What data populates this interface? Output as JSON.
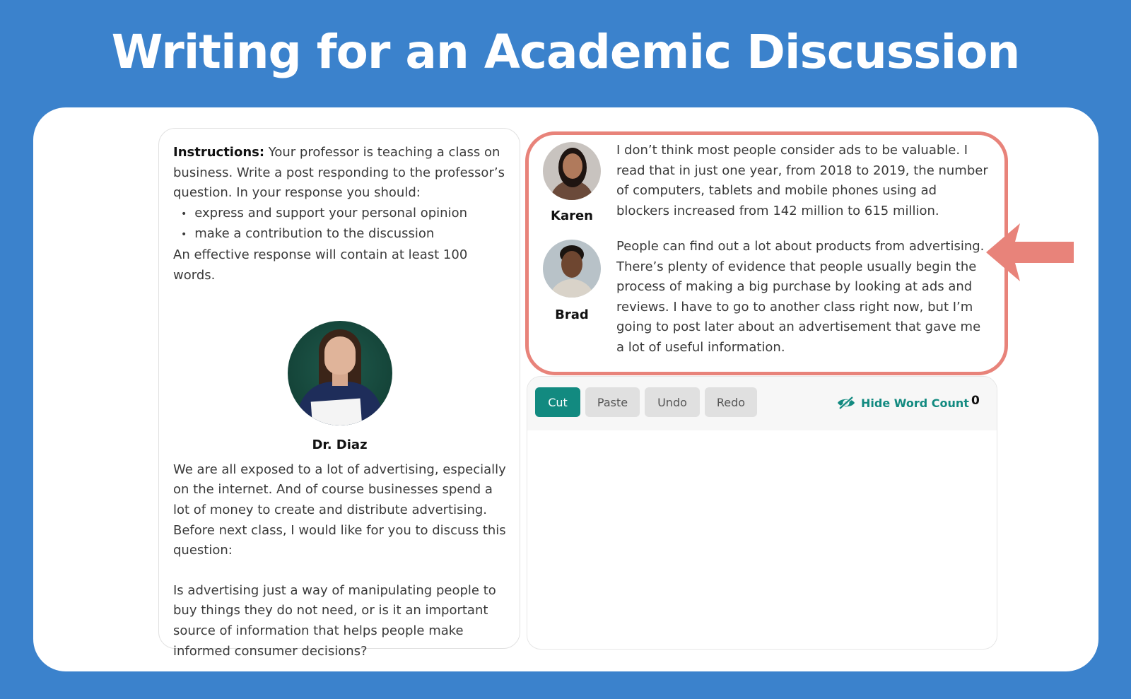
{
  "title": "Writing for an Academic Discussion",
  "instructions": {
    "label": "Instructions:",
    "text": " Your professor is teaching a class on business. Write a post responding to the professor’s question. In your response you should:",
    "bullets": [
      "express and support your personal opinion",
      "make a contribution to the discussion"
    ],
    "footer": "An effective response will contain at least 100 words."
  },
  "professor": {
    "name": "Dr. Diaz",
    "text": "We are all exposed to a lot of advertising, especially on the internet. And of course businesses spend a lot of money to create and distribute advertising. Before next class, I would like for you to discuss this question:",
    "question": "Is advertising just a way of manipulating people to buy things they do not need, or is it an important source of information that helps people make informed consumer decisions?"
  },
  "students": [
    {
      "name": "Karen",
      "text": "I don’t think most people consider ads to be valuable. I read that in just one year, from 2018 to 2019, the number of computers, tablets and mobile phones using ad blockers increased from 142 million to 615 million."
    },
    {
      "name": "Brad",
      "text": "People can find out a lot about products from advertising. There’s plenty of evidence that people usually begin the process of making a big purchase by looking at ads and reviews. I have to go to another class right now, but I’m going to post later about an advertisement that gave me a lot of useful information."
    }
  ],
  "toolbar": {
    "cut": "Cut",
    "paste": "Paste",
    "undo": "Undo",
    "redo": "Redo",
    "hide_word_count": "Hide Word Count",
    "word_count": "0",
    "toggle_icon": "eye-slash-icon"
  },
  "editor": {
    "value": ""
  },
  "colors": {
    "background": "#3b82cc",
    "highlight": "#e8837a",
    "accent": "#128a80"
  }
}
